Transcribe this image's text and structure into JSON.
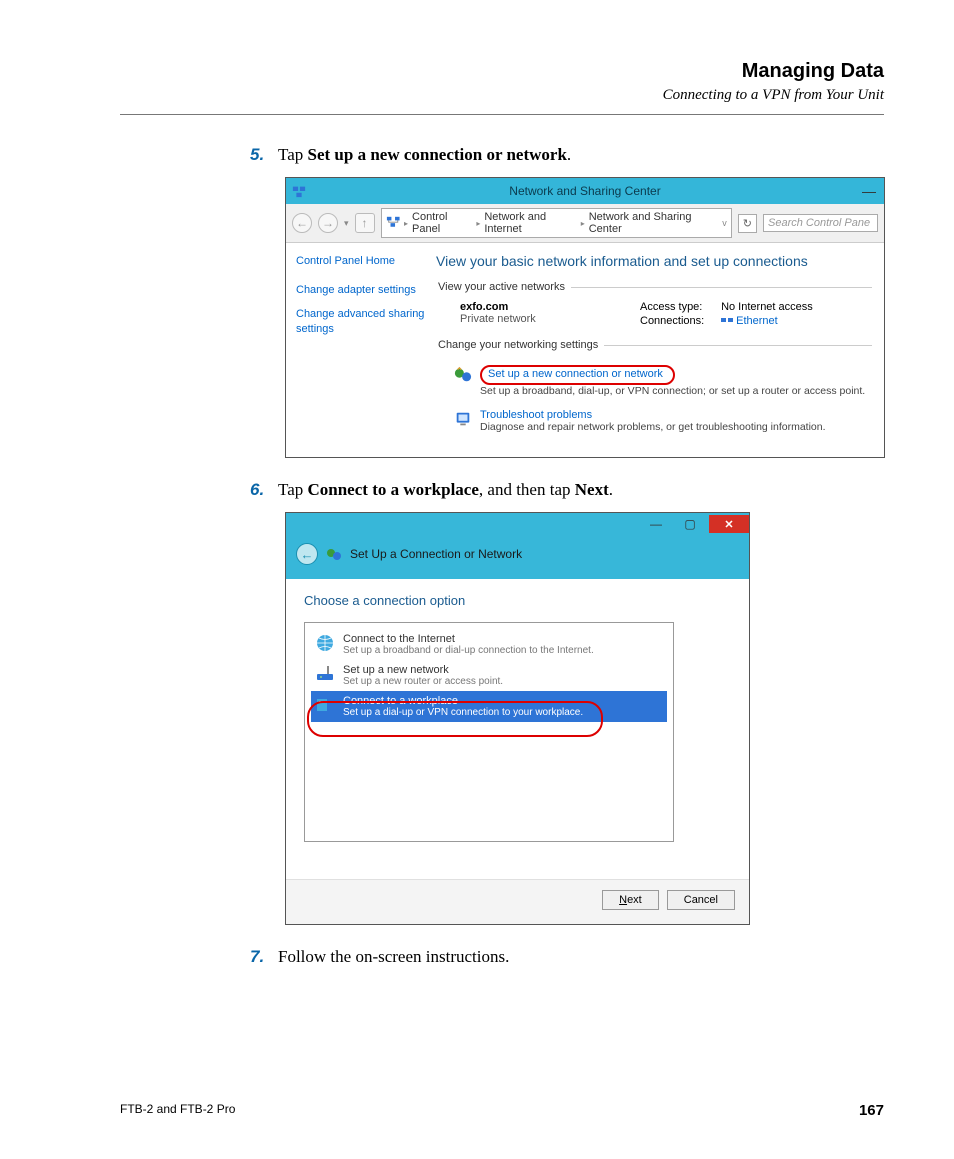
{
  "page_header": {
    "title": "Managing Data",
    "subtitle": "Connecting to a VPN from Your Unit"
  },
  "steps": {
    "s5": {
      "num": "5.",
      "prefix": "Tap ",
      "bold": "Set up a new connection or network",
      "suffix": "."
    },
    "s6": {
      "num": "6.",
      "prefix": "Tap ",
      "bold1": "Connect to a workplace",
      "mid": ", and then tap ",
      "bold2": "Next",
      "suffix": "."
    },
    "s7": {
      "num": "7.",
      "text": "Follow the on-screen instructions."
    }
  },
  "nsc": {
    "window_title": "Network and Sharing Center",
    "breadcrumb": {
      "b1": "Control Panel",
      "b2": "Network and Internet",
      "b3": "Network and Sharing Center"
    },
    "search_placeholder": "Search Control Pane",
    "sidebar": {
      "home": "Control Panel Home",
      "adapter": "Change adapter settings",
      "advanced": "Change advanced sharing settings"
    },
    "heading": "View your basic network information and set up connections",
    "active_group": "View your active networks",
    "network": {
      "name": "exfo.com",
      "type": "Private network",
      "access_label": "Access type:",
      "access_value": "No Internet access",
      "conn_label": "Connections:",
      "conn_value": "Ethernet"
    },
    "change_group": "Change your networking settings",
    "setup": {
      "title": "Set up a new connection or network",
      "desc": "Set up a broadband, dial-up, or VPN connection; or set up a router or access point."
    },
    "troubleshoot": {
      "title": "Troubleshoot problems",
      "desc": "Diagnose and repair network problems, or get troubleshooting information."
    }
  },
  "wiz": {
    "window_title": "Set Up a Connection or Network",
    "heading": "Choose a connection option",
    "opt1": {
      "title": "Connect to the Internet",
      "desc": "Set up a broadband or dial-up connection to the Internet."
    },
    "opt2": {
      "title": "Set up a new network",
      "desc": "Set up a new router or access point."
    },
    "opt3": {
      "title": "Connect to a workplace",
      "desc": "Set up a dial-up or VPN connection to your workplace."
    },
    "next_label": "Next",
    "cancel_label": "Cancel"
  },
  "footer": {
    "product": "FTB-2 and FTB-2 Pro",
    "page_number": "167"
  }
}
